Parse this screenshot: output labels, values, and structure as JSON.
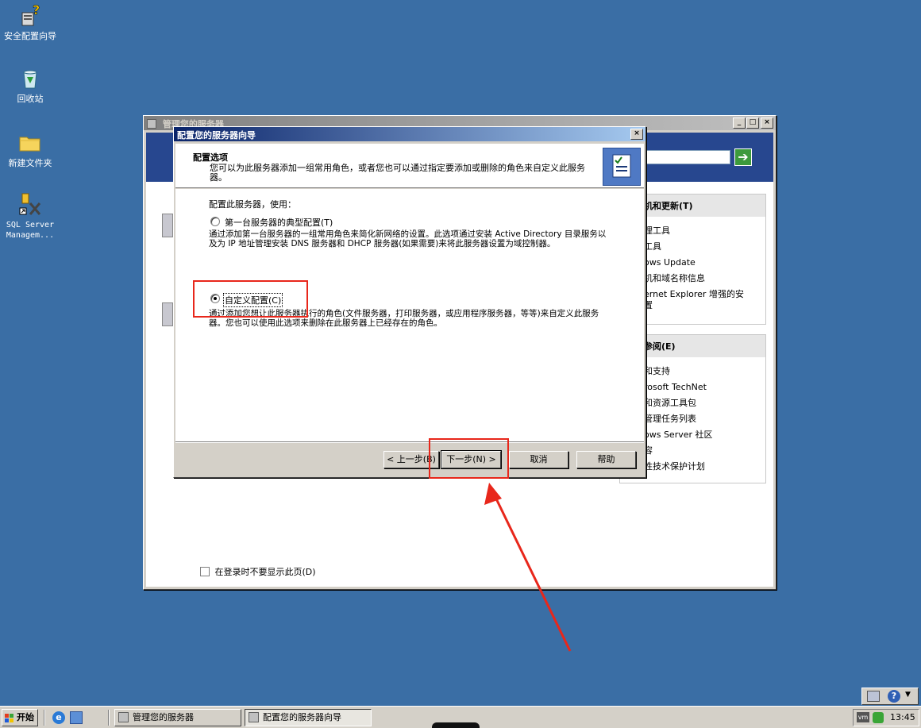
{
  "desktop": {
    "icons": [
      {
        "label": "安全配置向导"
      },
      {
        "label": "回收站"
      },
      {
        "label": "新建文件夹"
      },
      {
        "label": "SQL Server Managem..."
      }
    ]
  },
  "manage_window": {
    "title": "管理您的服务器",
    "right_panel": {
      "section1_title": "机和更新(T)",
      "section1_items": [
        "理工具",
        "工具",
        "ows Update",
        "机和域名称信息",
        "ernet Explorer 增强的安",
        "置"
      ],
      "section2_title": "参阅(E)",
      "section2_items": [
        "和支持",
        "rosoft TechNet",
        "和资源工具包",
        "管理任务列表",
        "ows Server 社区",
        "容",
        "性技术保护计划"
      ]
    },
    "footer_checkbox": "在登录时不要显示此页(D)"
  },
  "wizard": {
    "title": "配置您的服务器向导",
    "header_title": "配置选项",
    "header_desc": "您可以为此服务器添加一组常用角色，或者您也可以通过指定要添加或删除的角色来自定义此服务器。",
    "configure_label": "配置此服务器，使用：",
    "option1_label": "第一台服务器的典型配置(T)",
    "option1_desc": "通过添加第一台服务器的一组常用角色来简化新网络的设置。此选项通过安装 Active Directory 目录服务以及为 IP 地址管理安装 DNS 服务器和 DHCP 服务器(如果需要)来将此服务器设置为域控制器。",
    "option2_label": "自定义配置(C)",
    "option2_desc": "通过添加您想让此服务器执行的角色(文件服务器，打印服务器，或应用程序服务器，等等)来自定义此服务器。您也可以使用此选项来删除在此服务器上已经存在的角色。",
    "btn_back": "< 上一步(B)",
    "btn_next": "下一步(N) >",
    "btn_cancel": "取消",
    "btn_help": "帮助"
  },
  "taskbar": {
    "start_label": "开始",
    "tasks": [
      "管理您的服务器",
      "配置您的服务器向导"
    ],
    "clock": "13:45"
  },
  "colors": {
    "desktop": "#3a6ea5",
    "annotation": "#e8271b"
  }
}
